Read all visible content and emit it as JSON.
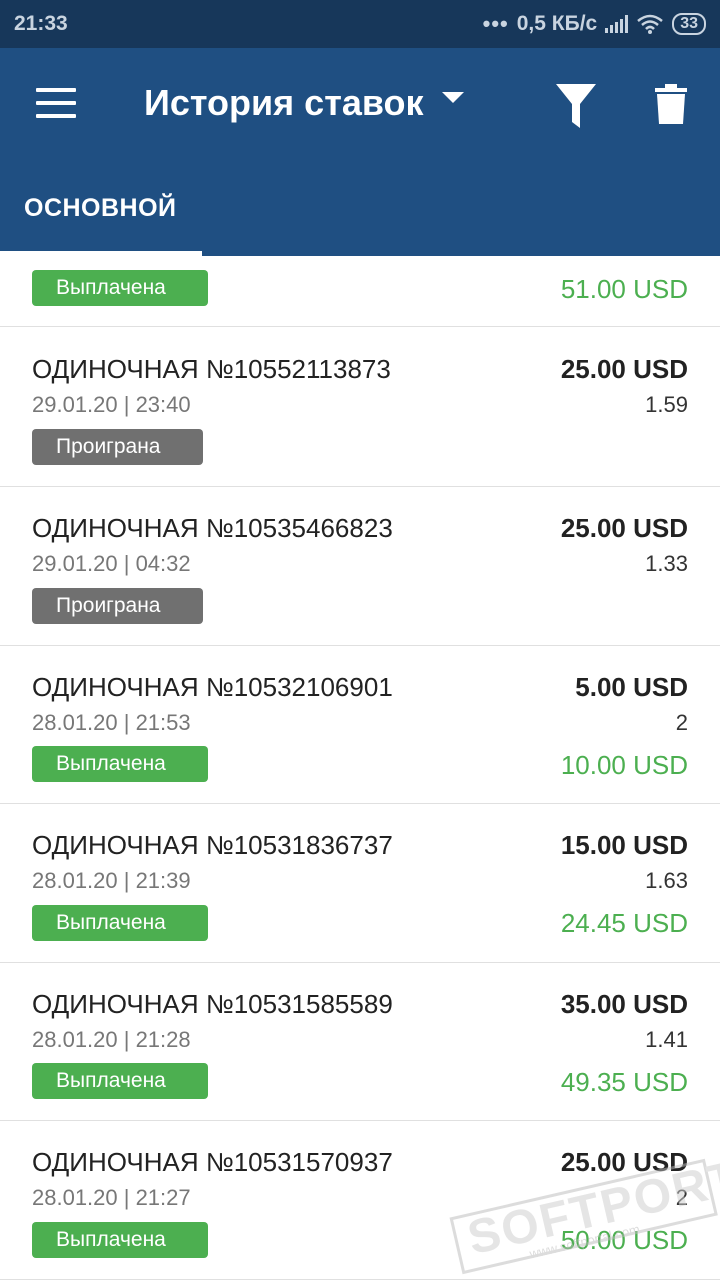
{
  "status_bar": {
    "time": "21:33",
    "network_speed": "0,5 КБ/с",
    "battery": "33"
  },
  "app_bar": {
    "title": "История ставок",
    "icons": [
      "menu-icon",
      "caret-down-icon",
      "filter-icon",
      "trash-icon"
    ]
  },
  "tabs": [
    {
      "label": "ОСНОВНОЙ",
      "selected": true
    }
  ],
  "bets": [
    {
      "title": "",
      "date": "",
      "status": "Выплачена",
      "status_type": "win",
      "stake": "",
      "odds": "",
      "payout": "51.00 USD"
    },
    {
      "title": "ОДИНОЧНАЯ №10552113873",
      "date": "29.01.20 | 23:40",
      "status": "Проиграна",
      "status_type": "lose",
      "stake": "25.00 USD",
      "odds": "1.59",
      "payout": ""
    },
    {
      "title": "ОДИНОЧНАЯ №10535466823",
      "date": "29.01.20 | 04:32",
      "status": "Проиграна",
      "status_type": "lose",
      "stake": "25.00 USD",
      "odds": "1.33",
      "payout": ""
    },
    {
      "title": "ОДИНОЧНАЯ №10532106901",
      "date": "28.01.20 | 21:53",
      "status": "Выплачена",
      "status_type": "win",
      "stake": "5.00 USD",
      "odds": "2",
      "payout": "10.00 USD"
    },
    {
      "title": "ОДИНОЧНАЯ №10531836737",
      "date": "28.01.20 | 21:39",
      "status": "Выплачена",
      "status_type": "win",
      "stake": "15.00 USD",
      "odds": "1.63",
      "payout": "24.45 USD"
    },
    {
      "title": "ОДИНОЧНАЯ №10531585589",
      "date": "28.01.20 | 21:28",
      "status": "Выплачена",
      "status_type": "win",
      "stake": "35.00 USD",
      "odds": "1.41",
      "payout": "49.35 USD"
    },
    {
      "title": "ОДИНОЧНАЯ №10531570937",
      "date": "28.01.20 | 21:27",
      "status": "Выплачена",
      "status_type": "win",
      "stake": "25.00 USD",
      "odds": "2",
      "payout": "50.00 USD"
    }
  ],
  "colors": {
    "status_bar": "#17375a",
    "app_bar": "#1f4f82",
    "win": "#4caf50",
    "lose": "#707070"
  },
  "watermark": {
    "brand": "SOFTPORTAL",
    "url": "www.softportal.com"
  }
}
